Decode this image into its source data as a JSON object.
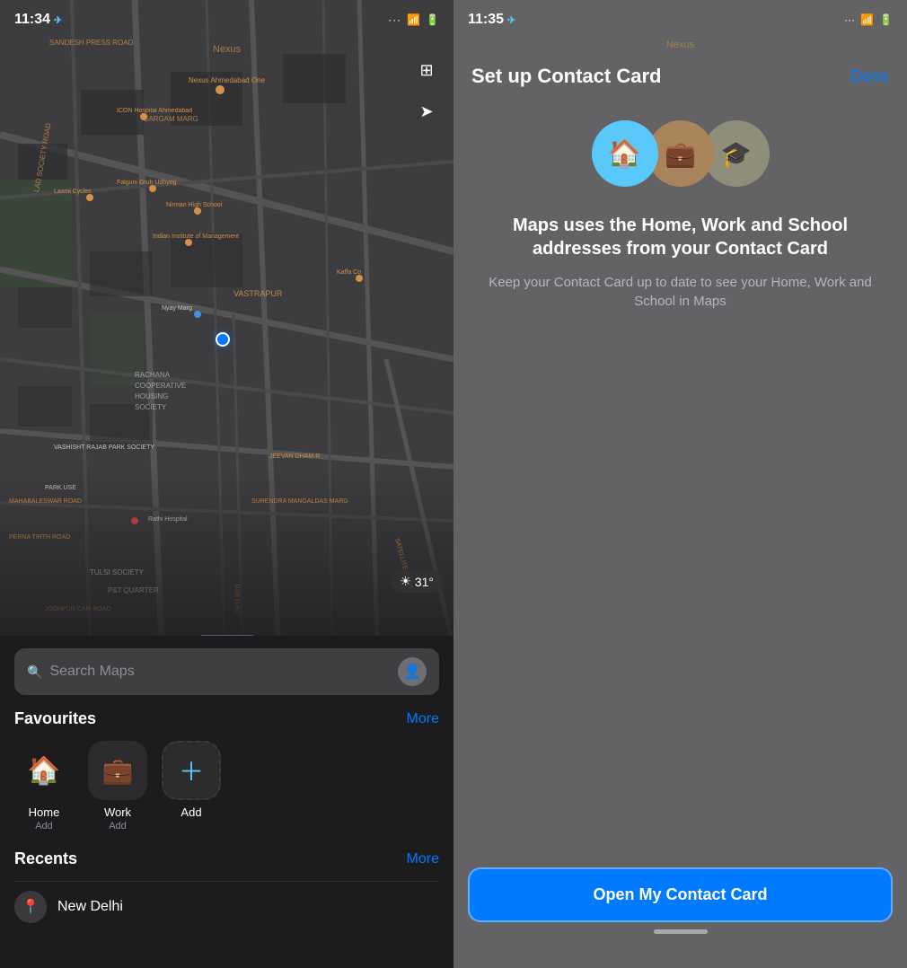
{
  "left": {
    "statusBar": {
      "time": "11:34",
      "locationIcon": "▶",
      "signalDots": "···",
      "wifi": "WiFi",
      "battery": "▭"
    },
    "nexusBanner": "Nexus",
    "weather": {
      "icon": "☀",
      "temp": "31°"
    },
    "mapControls": {
      "mapIcon": "⊞",
      "locationIcon": "➤"
    },
    "searchBar": {
      "placeholder": "Search Maps",
      "icon": "🔍"
    },
    "favourites": {
      "sectionTitle": "Favourites",
      "more": "More",
      "items": [
        {
          "icon": "🏠",
          "label": "Home",
          "sublabel": "Add",
          "type": "home"
        },
        {
          "icon": "💼",
          "label": "Work",
          "sublabel": "Add",
          "type": "work"
        },
        {
          "icon": "+",
          "label": "Add",
          "sublabel": "",
          "type": "add"
        }
      ]
    },
    "recents": {
      "sectionTitle": "Recents",
      "more": "More",
      "items": [
        {
          "label": "New Delhi",
          "icon": "📍"
        }
      ]
    }
  },
  "right": {
    "statusBar": {
      "time": "11:35",
      "locationIcon": "▶",
      "signalDots": "···",
      "wifi": "WiFi",
      "battery": "▭"
    },
    "nexusBanner": "Nexus",
    "titleBar": {
      "title": "Set up Contact Card",
      "doneLabel": "Done"
    },
    "icons": [
      {
        "type": "home",
        "symbol": "🏠"
      },
      {
        "type": "work",
        "symbol": "💼"
      },
      {
        "type": "school",
        "symbol": "🎓"
      }
    ],
    "description": {
      "main": "Maps uses the Home, Work and School addresses from your Contact Card",
      "sub": "Keep your Contact Card up to date to see your Home, Work and School in Maps"
    },
    "openContactBtn": "Open My Contact Card"
  }
}
